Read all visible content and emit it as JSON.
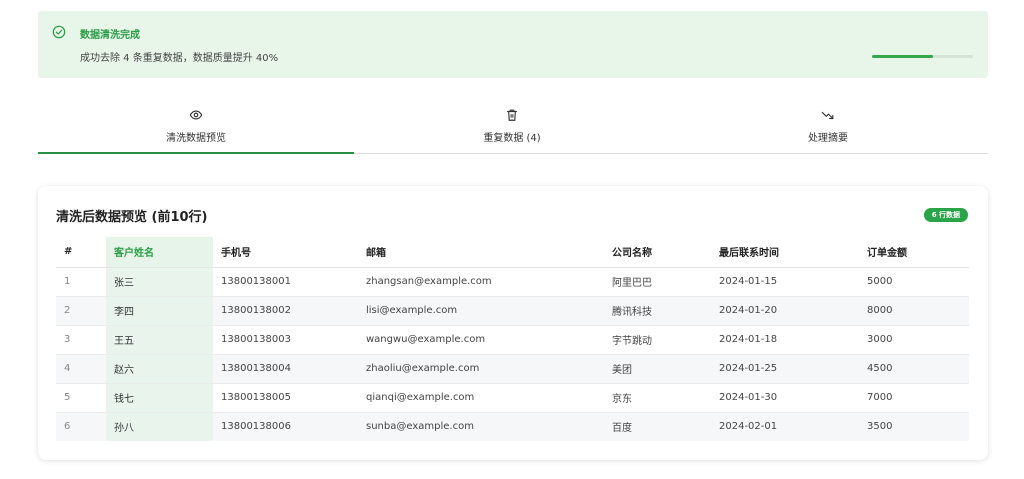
{
  "alert": {
    "title": "数据清洗完成",
    "description": "成功去除 4 条重复数据，数据质量提升 40%",
    "progress_percent": 60,
    "accent": "#2a9d45"
  },
  "tabs": [
    {
      "label": "清洗数据预览",
      "icon": "eye-icon",
      "active": true
    },
    {
      "label": "重复数据 (4)",
      "icon": "trash-icon",
      "active": false
    },
    {
      "label": "处理摘要",
      "icon": "trending-down-icon",
      "active": false
    }
  ],
  "card": {
    "title": "清洗后数据预览 (前10行)",
    "badge": "6 行数据"
  },
  "table": {
    "headers": [
      "#",
      "客户姓名",
      "手机号",
      "邮箱",
      "公司名称",
      "最后联系时间",
      "订单金额"
    ],
    "rows": [
      [
        "1",
        "张三",
        "13800138001",
        "zhangsan@example.com",
        "阿里巴巴",
        "2024-01-15",
        "5000"
      ],
      [
        "2",
        "李四",
        "13800138002",
        "lisi@example.com",
        "腾讯科技",
        "2024-01-20",
        "8000"
      ],
      [
        "3",
        "王五",
        "13800138003",
        "wangwu@example.com",
        "字节跳动",
        "2024-01-18",
        "3000"
      ],
      [
        "4",
        "赵六",
        "13800138004",
        "zhaoliu@example.com",
        "美团",
        "2024-01-25",
        "4500"
      ],
      [
        "5",
        "钱七",
        "13800138005",
        "qianqi@example.com",
        "京东",
        "2024-01-30",
        "7000"
      ],
      [
        "6",
        "孙八",
        "13800138006",
        "sunba@example.com",
        "百度",
        "2024-02-01",
        "3500"
      ]
    ]
  }
}
